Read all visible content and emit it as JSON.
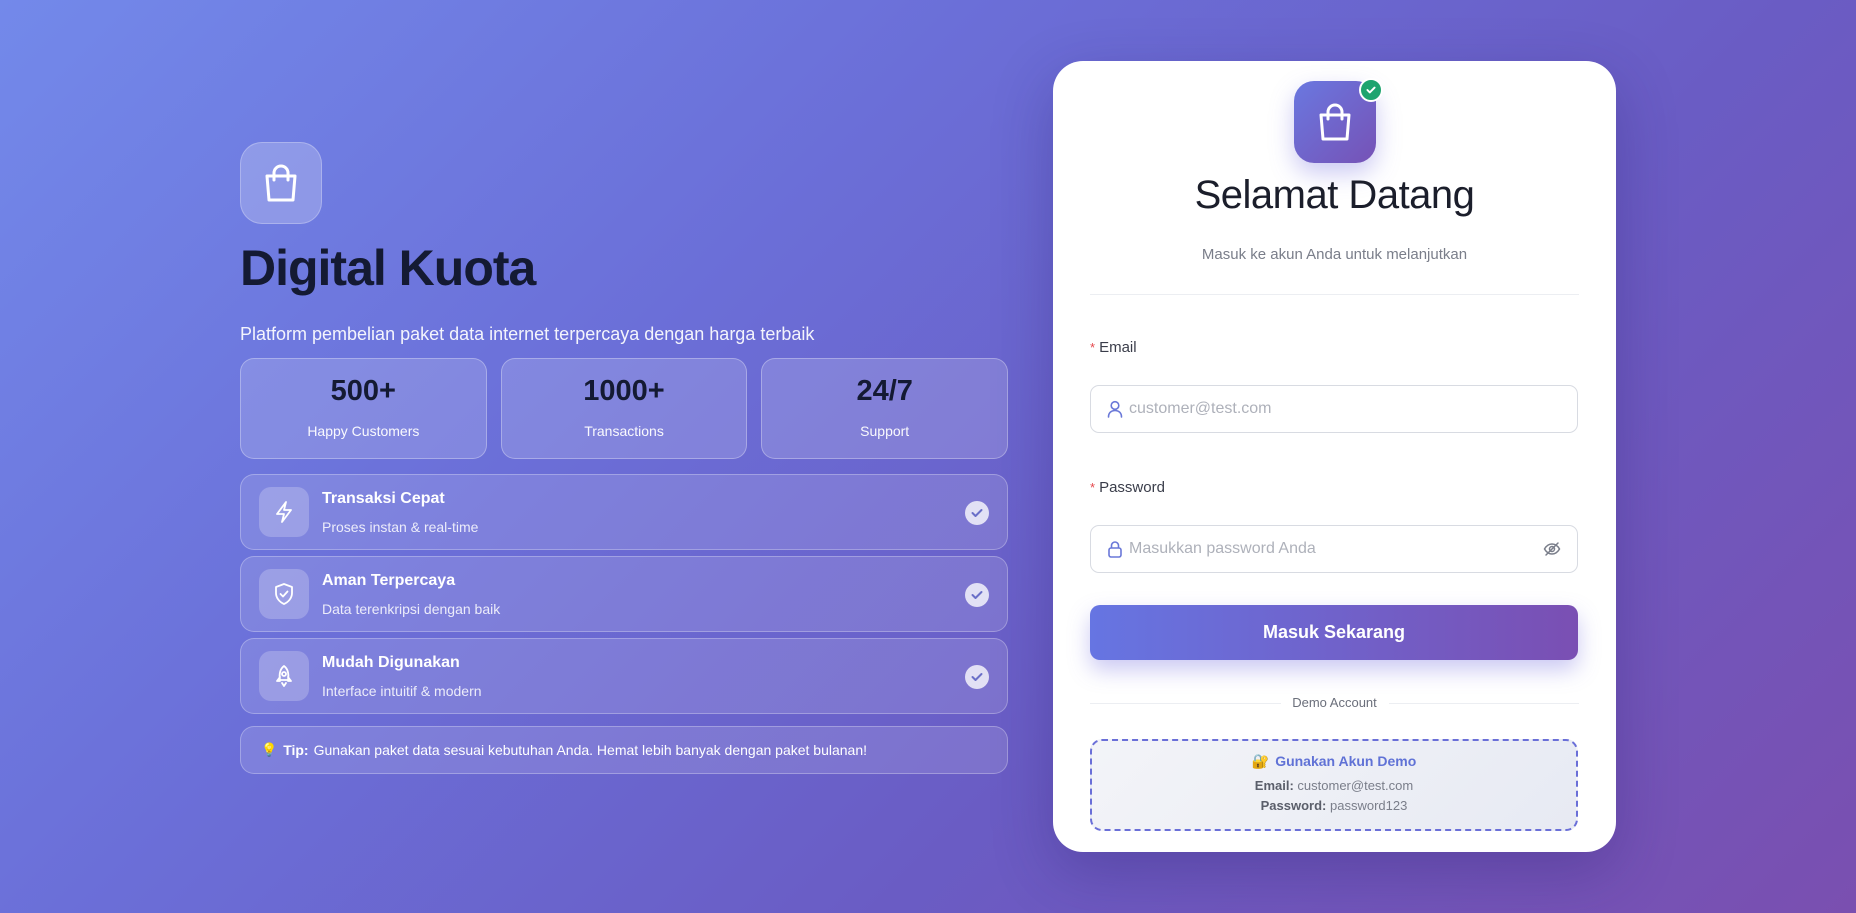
{
  "brand": {
    "title": "Digital Kuota",
    "subtitle": "Platform pembelian paket data internet terpercaya dengan harga terbaik",
    "logo_icon": "shopping-bag-icon"
  },
  "stats": [
    {
      "value": "500+",
      "label": "Happy Customers"
    },
    {
      "value": "1000+",
      "label": "Transactions"
    },
    {
      "value": "24/7",
      "label": "Support"
    }
  ],
  "features": [
    {
      "title": "Transaksi Cepat",
      "desc": "Proses instan & real-time",
      "icon": "lightning-icon"
    },
    {
      "title": "Aman Terpercaya",
      "desc": "Data terenkripsi dengan baik",
      "icon": "shield-check-icon"
    },
    {
      "title": "Mudah Digunakan",
      "desc": "Interface intuitif & modern",
      "icon": "rocket-icon"
    }
  ],
  "tip": {
    "label": "Tip:",
    "text": "Gunakan paket data sesuai kebutuhan Anda. Hemat lebih banyak dengan paket bulanan!"
  },
  "login": {
    "title": "Selamat Datang",
    "subtitle": "Masuk ke akun Anda untuk melanjutkan",
    "required_mark": "*",
    "email_label": "Email",
    "email_placeholder": "customer@test.com",
    "password_label": "Password",
    "password_placeholder": "Masukkan password Anda",
    "submit_label": "Masuk Sekarang",
    "demo_separator": "Demo Account",
    "demo": {
      "title": "Gunakan Akun Demo",
      "email_key": "Email:",
      "email_value": "customer@test.com",
      "password_key": "Password:",
      "password_value": "password123"
    }
  },
  "colors": {
    "accent_start": "#6675e2",
    "accent_end": "#7a4fb3",
    "badge_green": "#1ea46f",
    "required_red": "#e5484d"
  }
}
